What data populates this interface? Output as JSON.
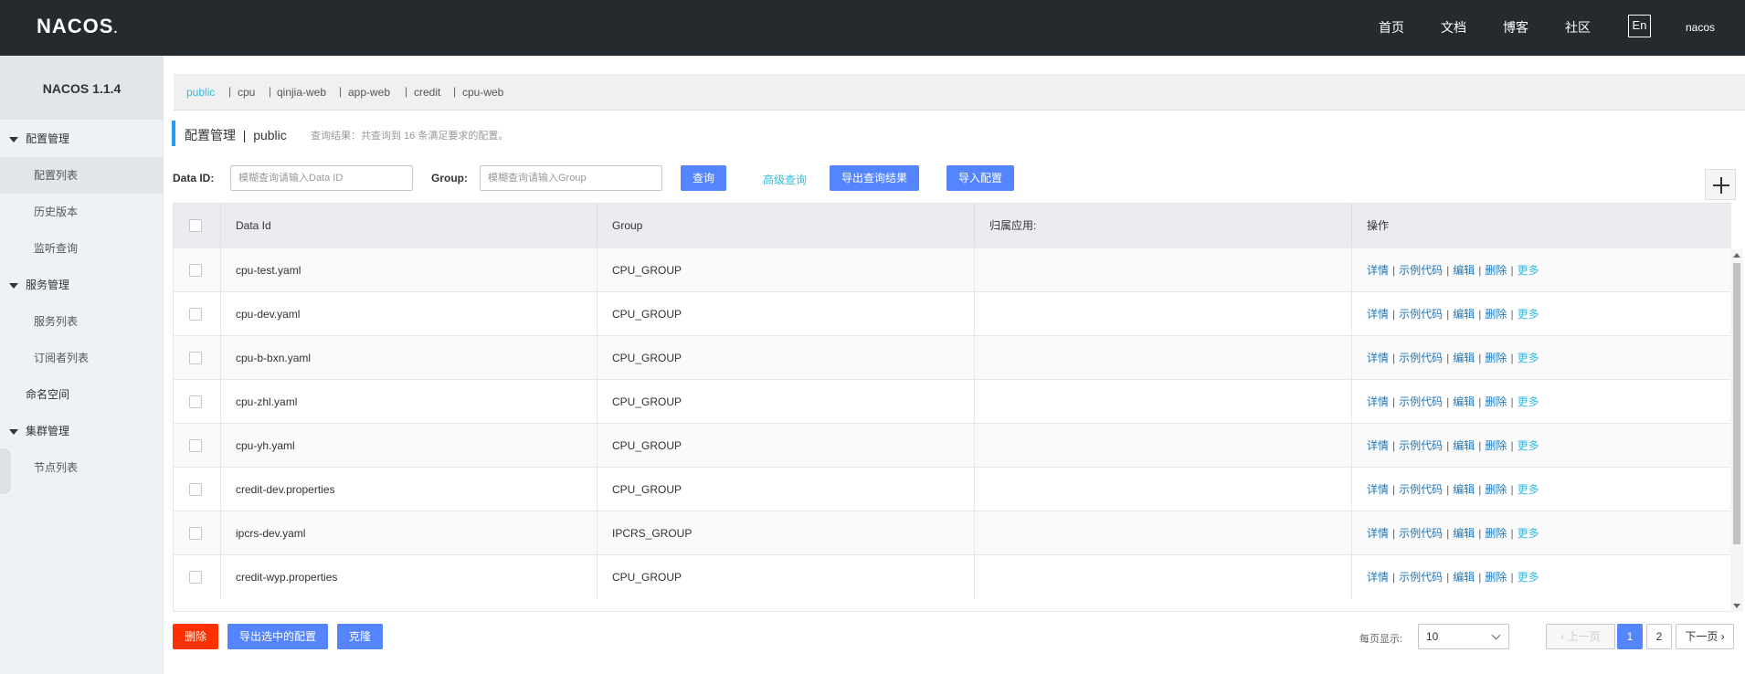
{
  "header": {
    "logo": "NACOS",
    "nav": [
      "首页",
      "文档",
      "博客",
      "社区"
    ],
    "lang": "En",
    "user": "nacos"
  },
  "sidebar": {
    "version": "NACOS 1.1.4",
    "config_group": "配置管理",
    "config_items": [
      "配置列表",
      "历史版本",
      "监听查询"
    ],
    "service_group": "服务管理",
    "service_items": [
      "服务列表",
      "订阅者列表"
    ],
    "namespace": "命名空间",
    "cluster_group": "集群管理",
    "cluster_items": [
      "节点列表"
    ]
  },
  "namespaces": [
    "public",
    "cpu",
    "qinjia-web",
    "app-web",
    "credit",
    "cpu-web"
  ],
  "title": {
    "section": "配置管理",
    "separator": "|",
    "namespace": "public",
    "info": "查询结果：共查询到 16 条满足要求的配置。"
  },
  "search": {
    "dataid_label": "Data ID:",
    "dataid_placeholder": "模糊查询请输入Data ID",
    "group_label": "Group:",
    "group_placeholder": "模糊查询请输入Group",
    "query": "查询",
    "advanced": "高级查询",
    "export_results": "导出查询结果",
    "import": "导入配置"
  },
  "table": {
    "columns": [
      "Data Id",
      "Group",
      "归属应用:",
      "操作"
    ],
    "rows": [
      {
        "dataid": "cpu-test.yaml",
        "group": "CPU_GROUP",
        "app": ""
      },
      {
        "dataid": "cpu-dev.yaml",
        "group": "CPU_GROUP",
        "app": ""
      },
      {
        "dataid": "cpu-b-bxn.yaml",
        "group": "CPU_GROUP",
        "app": ""
      },
      {
        "dataid": "cpu-zhl.yaml",
        "group": "CPU_GROUP",
        "app": ""
      },
      {
        "dataid": "cpu-yh.yaml",
        "group": "CPU_GROUP",
        "app": ""
      },
      {
        "dataid": "credit-dev.properties",
        "group": "CPU_GROUP",
        "app": ""
      },
      {
        "dataid": "ipcrs-dev.yaml",
        "group": "IPCRS_GROUP",
        "app": ""
      },
      {
        "dataid": "credit-wyp.properties",
        "group": "CPU_GROUP",
        "app": ""
      }
    ],
    "ops": [
      "详情",
      "示例代码",
      "编辑",
      "删除",
      "更多"
    ]
  },
  "bottom": {
    "delete": "删除",
    "export_selected": "导出选中的配置",
    "clone": "克隆",
    "page_size_label": "每页显示:",
    "page_size": "10",
    "prev": "上一页",
    "pages": [
      "1",
      "2"
    ],
    "next": "下一页"
  }
}
